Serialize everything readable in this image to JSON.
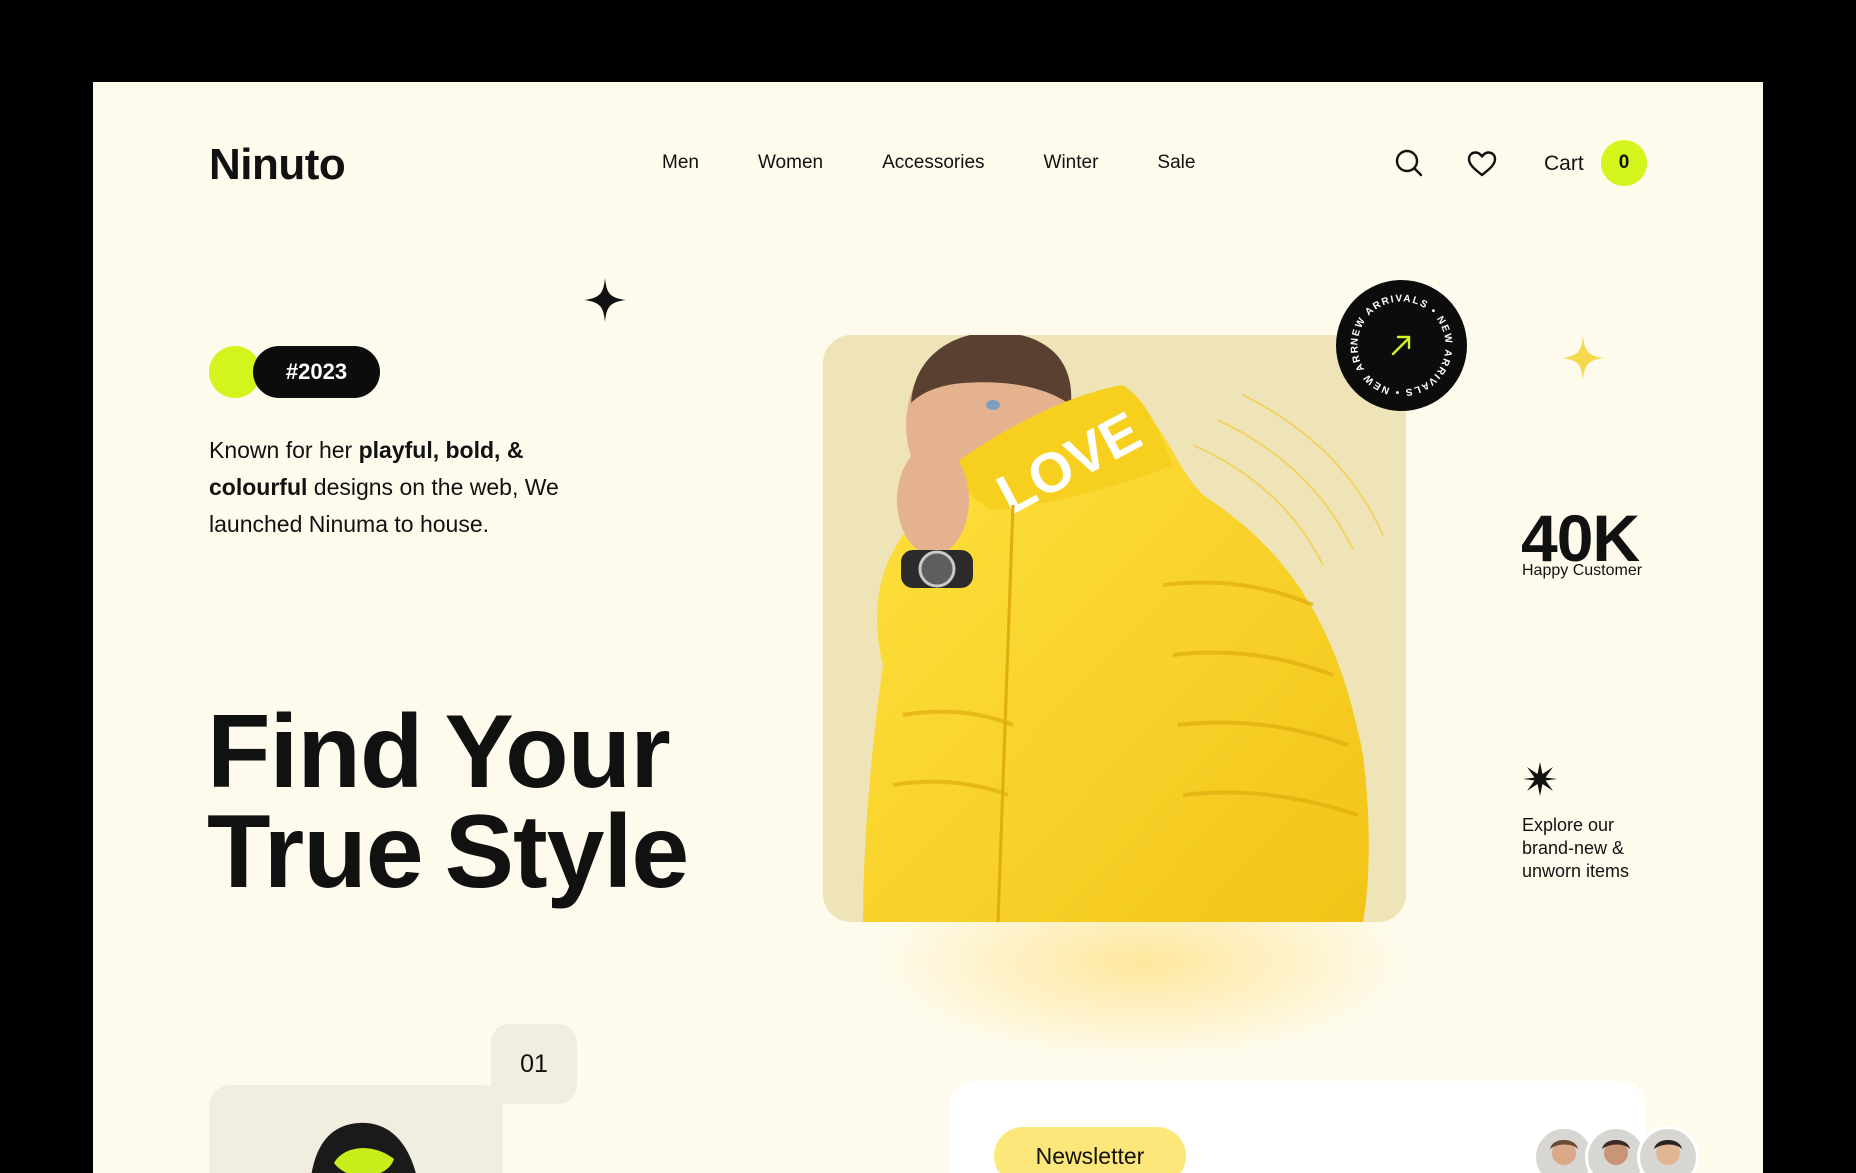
{
  "header": {
    "logo": "Ninuto",
    "nav": [
      "Men",
      "Women",
      "Accessories",
      "Winter",
      "Sale"
    ],
    "cart_label": "Cart",
    "cart_count": "0"
  },
  "hero": {
    "tag": "#2023",
    "intro": {
      "part1": "Known for her ",
      "bold1": "playful, bold, &",
      "bold2": "colourful",
      "part2": " designs on the web, We launched Ninuma to house."
    },
    "headline": {
      "w1": "Find",
      "w2": "Your",
      "w3": "True",
      "w4": "Style"
    },
    "badge_text": "NEW ARRIVALS • NEW ARRIVALS • NEW ARRIVALS •",
    "stat_value": "40K",
    "stat_label": "Happy Customer",
    "explore_text": "Explore our brand-new & unworn items"
  },
  "product_card": {
    "number": "01"
  },
  "newsletter": {
    "button_label": "Newsletter"
  },
  "colors": {
    "background": "#fefbed",
    "accent_lime": "#d4f51c",
    "accent_yellow": "#fde77a",
    "dark": "#0c0c0c"
  }
}
